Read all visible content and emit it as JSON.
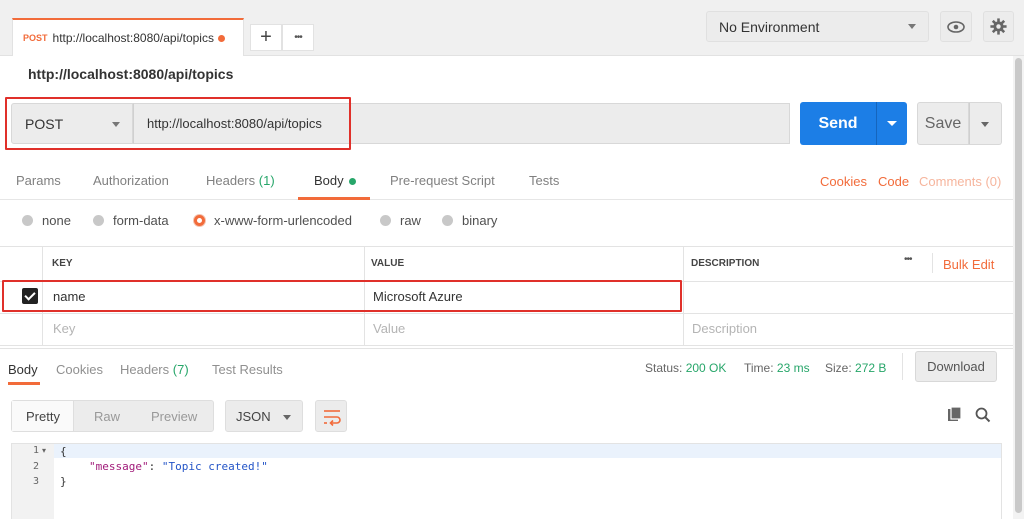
{
  "tabs": [
    {
      "method": "POST",
      "title": "http://localhost:8080/api/topics",
      "unsaved": true
    }
  ],
  "tabbar": {
    "new_tab": "+",
    "more": "•••"
  },
  "environment": {
    "selected": "No Environment"
  },
  "icons": {
    "eye": "eye-icon",
    "settings": "gear-icon"
  },
  "request": {
    "name": "http://localhost:8080/api/topics",
    "method": "POST",
    "url": "http://localhost:8080/api/topics",
    "send_label": "Send",
    "save_label": "Save"
  },
  "request_tabs": {
    "params": "Params",
    "authorization": "Authorization",
    "headers": "Headers",
    "headers_count": "(1)",
    "body": "Body",
    "prerequest": "Pre-request Script",
    "tests": "Tests",
    "cookies": "Cookies",
    "code": "Code",
    "comments": "Comments (0)"
  },
  "body_types": [
    "none",
    "form-data",
    "x-www-form-urlencoded",
    "raw",
    "binary"
  ],
  "body_type_selected": "x-www-form-urlencoded",
  "kv_table": {
    "columns": {
      "key": "KEY",
      "value": "VALUE",
      "description": "DESCRIPTION"
    },
    "more": "•••",
    "bulk_edit": "Bulk Edit",
    "rows": [
      {
        "checked": true,
        "key": "name",
        "value": "Microsoft Azure",
        "description": ""
      }
    ],
    "placeholders": {
      "key": "Key",
      "value": "Value",
      "description": "Description"
    }
  },
  "response_tabs": {
    "body": "Body",
    "cookies": "Cookies",
    "headers": "Headers",
    "headers_count": "(7)",
    "test_results": "Test Results"
  },
  "response_status": {
    "status_label": "Status:",
    "status_value": "200 OK",
    "time_label": "Time:",
    "time_value": "23 ms",
    "size_label": "Size:",
    "size_value": "272 B",
    "download": "Download"
  },
  "response_format": {
    "pretty": "Pretty",
    "raw": "Raw",
    "preview": "Preview",
    "selected": "JSON"
  },
  "response_body": {
    "line_numbers": [
      "1",
      "2",
      "3"
    ],
    "line1": "{",
    "key": "\"message\"",
    "colon": ": ",
    "value": "\"Topic created!\"",
    "line3": "}"
  },
  "colors": {
    "accent": "#f26b3a",
    "send": "#1c7ee6",
    "success": "#27a66a",
    "highlight": "#e0302a"
  }
}
